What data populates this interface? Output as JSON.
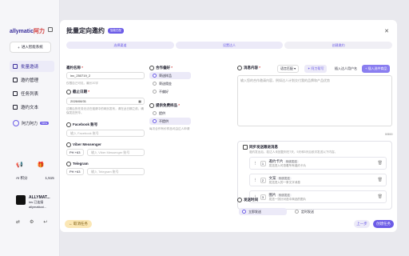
{
  "sidebar": {
    "logo_main": "allymatic",
    "logo_accent": "阿力",
    "enter_btn": "进入智能系统",
    "items": [
      {
        "label": "批量邀请",
        "active": true
      },
      {
        "label": "邀约管理",
        "active": false
      },
      {
        "label": "任务列表",
        "active": false
      },
      {
        "label": "邀约文本",
        "active": false
      }
    ],
    "brand_label": "阿力阿力",
    "brand_badge": "New",
    "ai_label": "AI 积分",
    "ai_value": "1,515",
    "account_name": "ALLYMAT...",
    "account_line2": "ins 已连接",
    "account_line3": "allymaticai..."
  },
  "main": {
    "title": "批量定向邀约",
    "badge": "智能匹配",
    "steps": [
      "选择渠道",
      "设置达人",
      "创建邀约"
    ],
    "name_label": "邀约名称",
    "name_value": "inv_250719_2",
    "name_hint": "仅限自己可见，最长20字",
    "deadline_label": "截止日期",
    "deadline_value": "2026/08/31",
    "deadline_hint": "过期后的任务无法在邀请中的网页发布，请在此日期之前，确保发送完毕。",
    "facebook_label": "Facebook 账号",
    "facebook_placeholder": "输入 Facebook 账号",
    "viber_label": "Viber Messenger",
    "viber_code": "PH +63",
    "viber_placeholder": "输入 Viber Messenger 账号",
    "telegram_label": "Telegram",
    "telegram_code": "PH +63",
    "telegram_placeholder": "输入 Telegram 账号",
    "coop_label": "合作偏好",
    "coop_options": [
      "寄送样品",
      "寄送佣金",
      "不偏好"
    ],
    "free_label": "提供免费样品",
    "free_options": [
      "提供",
      "不提供"
    ],
    "free_hint": "每次合作有价样品可由达人申请",
    "msg_label": "消息内容",
    "lang_select": "语言匹配",
    "ai_write": "阿力帮写",
    "insert_author": "插入达人用户名",
    "insert_product": "插入选中商品",
    "msg_placeholder": "输入您的合作邀请内容，例如达人计划交付我的品牌和产品优势",
    "msg_count": "0/500",
    "followup_label": "同步发送跟进消息",
    "followup_hint": "邀约发出后，若达人未回复则在7天，5天和3天后依次发送以下内容。",
    "followups": [
      {
        "num": "1",
        "title": "邀约卡片",
        "tag": "系统发送",
        "desc": "发送进入可查看所有邀约卡片"
      },
      {
        "num": "2",
        "title": "文案",
        "tag": "系统发送",
        "desc": "发送进入的一条文字消息"
      },
      {
        "num": "3",
        "title": "图片",
        "tag": "系统发送",
        "desc": "发送一张针对选中商品的图片"
      }
    ],
    "send_label": "发送时间",
    "send_now": "立即发送",
    "send_scheduled": "定时发送",
    "cancel_btn": "取消任务",
    "prev_btn": "上一步",
    "submit_btn": "创建任务"
  }
}
